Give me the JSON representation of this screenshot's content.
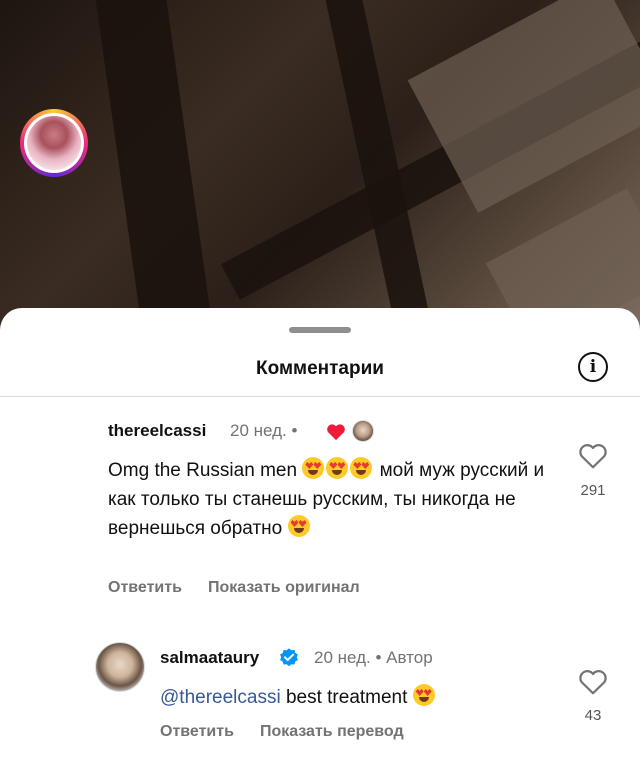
{
  "sheet": {
    "title": "Комментарии"
  },
  "comments": [
    {
      "username": "thereelcassi",
      "time": "20 нед.",
      "separator": "•",
      "text_before": "Omg the Russian men",
      "text_after": "мой муж русский и как только ты станешь русским, ты никогда не вернешься обратно",
      "reply_label": "Ответить",
      "secondary_action": "Показать оригинал",
      "likes": "291",
      "liked_by_author": true
    },
    {
      "username": "salmaataury",
      "verified": true,
      "time": "20 нед.",
      "separator": "•",
      "author_label": "Автор",
      "mention": "@thereelcassi",
      "text": "best treatment",
      "reply_label": "Ответить",
      "secondary_action": "Показать перевод",
      "likes": "43"
    }
  ],
  "colors": {
    "heart": "#ed1c3a",
    "verified": "#0095f6",
    "mention": "#385898",
    "muted": "#737373"
  },
  "icons": [
    "info-icon",
    "heart-outline-icon",
    "heart-filled-icon",
    "verified-badge-icon",
    "heart-eyes-emoji"
  ]
}
